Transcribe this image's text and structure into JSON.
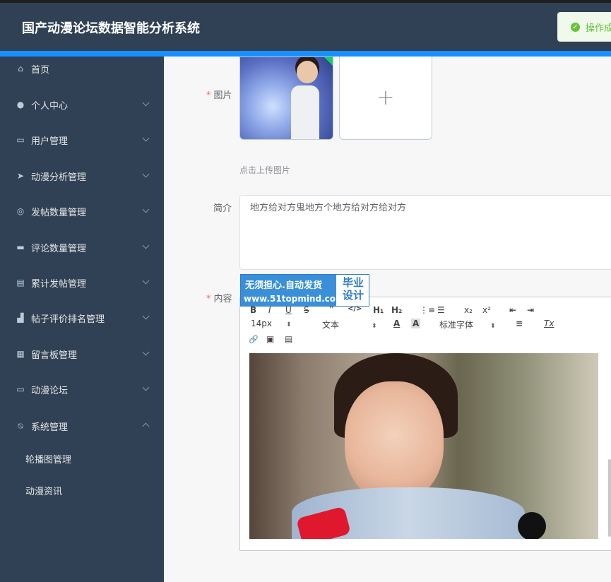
{
  "header": {
    "title": "国产动漫论坛数据智能分析系统"
  },
  "toast": {
    "message": "操作成",
    "icon": "check-circle-icon",
    "color": "#67c23a"
  },
  "sidebar": {
    "items": [
      {
        "label": "首页",
        "icon": "home-icon"
      },
      {
        "label": "个人中心",
        "icon": "user-icon"
      },
      {
        "label": "用户管理",
        "icon": "chat-icon"
      },
      {
        "label": "动漫分析管理",
        "icon": "send-icon"
      },
      {
        "label": "发帖数量管理",
        "icon": "target-icon"
      },
      {
        "label": "评论数量管理",
        "icon": "briefcase-icon"
      },
      {
        "label": "累计发帖管理",
        "icon": "clipboard-icon"
      },
      {
        "label": "帖子评价排名管理",
        "icon": "thumb-icon"
      },
      {
        "label": "留言板管理",
        "icon": "grid-icon"
      },
      {
        "label": "动漫论坛",
        "icon": "card-icon"
      },
      {
        "label": "系统管理",
        "icon": "bell-off-icon"
      }
    ],
    "subitems": [
      {
        "label": "轮播图管理"
      },
      {
        "label": "动漫资讯"
      }
    ]
  },
  "form": {
    "image_label": "图片",
    "upload_tip": "点击上传图片",
    "uploader_icon": "plus-icon",
    "intro_label": "简介",
    "intro_value": "地方给对方鬼地方个地方给对方给对方",
    "content_label": "内容"
  },
  "editor": {
    "toolbar": {
      "bold": "B",
      "italic": "I",
      "underline": "U",
      "strike": "S",
      "blockquote": "❞",
      "code": "</>",
      "h1": "H₁",
      "h2": "H₂",
      "ordered_list": "⋮≡",
      "bullet_list": "☰",
      "subscript": "x₂",
      "superscript": "x²",
      "outdent": "⇤",
      "indent": "⇥",
      "size": "14px",
      "header": "文本",
      "font_color": "A",
      "bg_color": "A",
      "font": "标准字体",
      "align": "≡",
      "clean": "Tx",
      "link": "🔗",
      "image": "▣",
      "video": "▤"
    }
  },
  "watermark": {
    "line1": "无须担心.自动发货",
    "line2": "www.51topmind.com",
    "right_line1": "毕业",
    "right_line2": "设计"
  }
}
